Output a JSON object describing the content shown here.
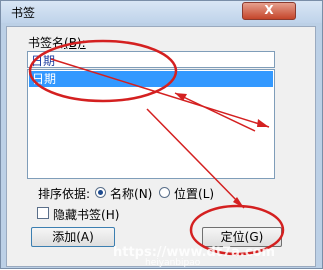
{
  "window": {
    "title": "书签",
    "close_glyph": "X"
  },
  "bookmark_name": {
    "label": "书签名",
    "hotkey": "(B):",
    "value": "日期"
  },
  "bookmark_list": {
    "items": [
      "日期"
    ]
  },
  "sort": {
    "label": "排序依据:",
    "options": [
      {
        "label": "名称",
        "hotkey": "(N)",
        "selected": true
      },
      {
        "label": "位置",
        "hotkey": "(L)",
        "selected": false
      }
    ]
  },
  "hidden_bookmarks": {
    "label": "隐藏书签",
    "hotkey": "(H)",
    "checked": false
  },
  "buttons": {
    "add": "添加(A)",
    "goto": "定位(G)"
  },
  "watermark": {
    "line1": "https://www.dt7a.com",
    "line2": "heiyanbipao"
  },
  "colors": {
    "annotation": "#d42020",
    "selection": "#3399ff",
    "title_bar": "#bfd3ea"
  }
}
